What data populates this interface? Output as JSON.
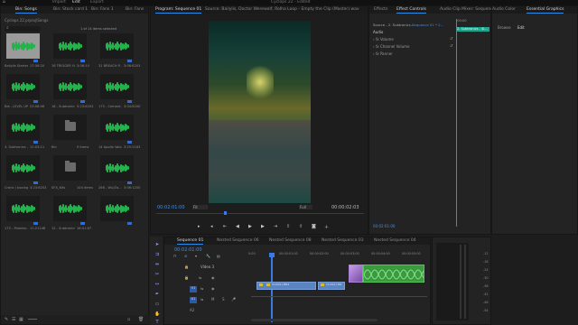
{
  "app": {
    "title": "Cyclops 22 - Edited",
    "menu": [
      "Import",
      "Edit",
      "Export"
    ],
    "home_icon": "home-icon"
  },
  "project": {
    "tabs": [
      "Bin: Songs",
      "Bin: Stock card 1",
      "Bin: Fans 1",
      "Bin: Fans"
    ],
    "bin_path": "Cyclops 22.prproj\\Songs",
    "items_selected": "1 of 14 items selected",
    "items": [
      {
        "name": "Bailylis Starter...",
        "dur": "17:36:20",
        "type": "audio",
        "selected": true
      },
      {
        "name": "16 TRIGGER HA...",
        "dur": "3:06:10",
        "type": "audio"
      },
      {
        "name": "31 BREACH P...",
        "dur": "3:06:6203",
        "type": "audio"
      },
      {
        "name": "Ble - LEVEL UP...",
        "dur": "23:08:06",
        "type": "audio"
      },
      {
        "name": "18 - Subtronics...",
        "dur": "5:23:6203",
        "type": "audio"
      },
      {
        "name": "175 - Cement...",
        "dur": "3:04:8200",
        "type": "audio"
      },
      {
        "name": "3. Subtronics -...",
        "dur": "11:03:11",
        "type": "audio"
      },
      {
        "name": "Bin",
        "dur": "9 items",
        "type": "folder"
      },
      {
        "name": "14 Apollo Valor...",
        "dur": "3:25:2163",
        "type": "audio"
      },
      {
        "name": "Crank ( boxing...",
        "dur": "3:23:6203",
        "type": "audio"
      },
      {
        "name": "SFX_Kits",
        "dur": "104 items",
        "type": "folder"
      },
      {
        "name": "266 - Wu/Zo...",
        "dur": "3:06:1200",
        "type": "audio"
      },
      {
        "name": "175 - Polardo...",
        "dur": "11:21148",
        "type": "audio"
      },
      {
        "name": "12 - Subtronics...",
        "dur": "16:41:67",
        "type": "audio"
      },
      {
        "name": "",
        "dur": "",
        "type": "audio"
      }
    ]
  },
  "monitor": {
    "tabs": [
      "Program: Sequence 01",
      "Source: Bailylis, Doctor Werewolf, Rolha Loop - Empty the Clip (Master).wav"
    ],
    "timecode_left": "00:02:01:00",
    "fit": "Fit",
    "quality": "Full",
    "timecode_right": "00:00:02:03"
  },
  "effects": {
    "tabs": [
      "Effects",
      "Effect Controls",
      "Audio Clip Mixer: Sequence 01"
    ],
    "source": "Source - 2. Subtronics...",
    "target": "Sequence 01 * 2...",
    "time": ":00:00",
    "time2": "00:02:13",
    "clip_label": "2. Subtronics - Sl...",
    "section": "Audio",
    "rows": [
      "Volume",
      "Channel Volume",
      "Panner"
    ],
    "footer_tc": "00:02:01:00"
  },
  "graphics": {
    "tabs": [
      "Audio Color",
      "Essential Graphics"
    ],
    "sub": [
      "Browse",
      "Edit"
    ]
  },
  "timeline": {
    "tabs": [
      "Sequence 01",
      "Nested Sequence 06",
      "Nested Sequence 08",
      "Nested Sequence 03",
      "Nested Sequence 04"
    ],
    "timecode": "00:02:01:00",
    "ruler": [
      "0:00",
      "00:00:01:00",
      "00:00:02:00",
      "00:00:03:00",
      "00:00:04:00",
      "00:00:05:00"
    ],
    "tracks": [
      "Video 3",
      "V2",
      "V1",
      "A1",
      "A2"
    ],
    "clips": [
      "1120(1).MP4",
      "1120(1).M4"
    ],
    "meter_labels": [
      "-12",
      "-18",
      "-24",
      "-30",
      "-36",
      "-42",
      "-48",
      "-54"
    ]
  },
  "colors": {
    "accent": "#2d8ceb",
    "audio": "#24b24c",
    "clip": "#5b84c2",
    "playhead": "#3c7ae3"
  }
}
